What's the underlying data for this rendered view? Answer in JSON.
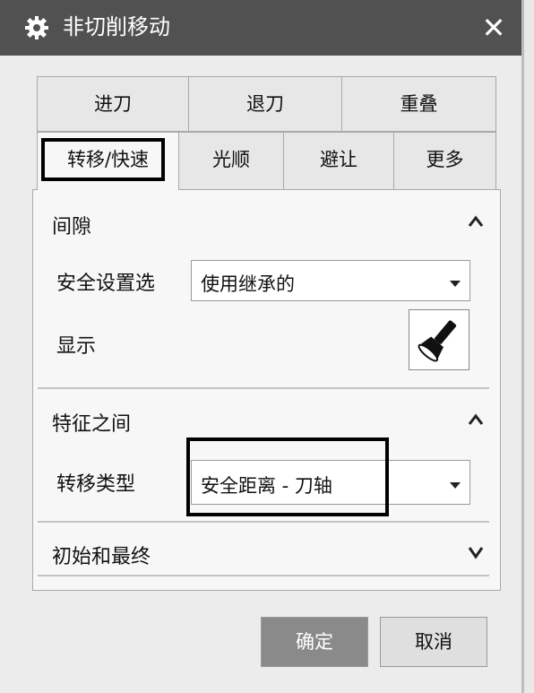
{
  "window": {
    "title": "非切削移动",
    "close": "✕"
  },
  "tabs_top": [
    "进刀",
    "退刀",
    "重叠"
  ],
  "tabs_bottom": [
    "转移/快速",
    "光顺",
    "避让",
    "更多"
  ],
  "sections": {
    "clearance": {
      "title": "间隙",
      "safety_label": "安全设置选",
      "safety_value": "使用继承的",
      "display_label": "显示"
    },
    "between_features": {
      "title": "特征之间",
      "transfer_type_label": "转移类型",
      "transfer_type_value": "安全距离 - 刀轴"
    },
    "initial_final": {
      "title": "初始和最终"
    }
  },
  "buttons": {
    "ok": "确定",
    "cancel": "取消"
  }
}
